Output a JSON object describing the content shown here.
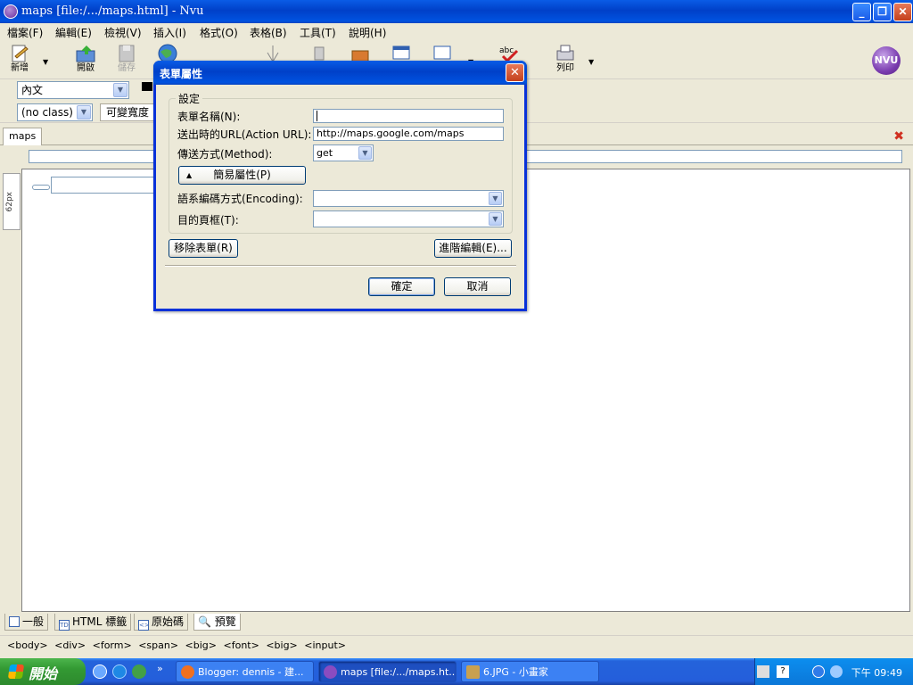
{
  "window": {
    "title": "maps [file:/.../maps.html] - Nvu"
  },
  "menu": [
    "檔案(F)",
    "編輯(E)",
    "檢視(V)",
    "插入(I)",
    "格式(O)",
    "表格(B)",
    "工具(T)",
    "說明(H)"
  ],
  "toolbar": {
    "new_label": "新增",
    "open_label": "開啟",
    "save_label": "儲存",
    "print_label": "列印",
    "logo_text": "NVU"
  },
  "format": {
    "paragraph_style": "內文",
    "class_value": "(no class)",
    "width_button": "可變寬度"
  },
  "document": {
    "tab_label": "maps",
    "side_ruler": "62px"
  },
  "mode_tabs": {
    "normal": "一般",
    "html_tags": "HTML 標籤",
    "source": "原始碼",
    "preview": "預覽"
  },
  "status": {
    "tags": "<body> <div> <form> <span> <big> <font> <big> <input>"
  },
  "dialog": {
    "title": "表單屬性",
    "group_label": "設定",
    "form_name_label": "表單名稱(N):",
    "form_name_value": "",
    "action_url_label": "送出時的URL(Action URL):",
    "action_url_value": "http://maps.google.com/maps",
    "method_label": "傳送方式(Method):",
    "method_value": "get",
    "simple_props_button": "簡易屬性(P)",
    "encoding_label": "語系編碼方式(Encoding):",
    "encoding_value": "",
    "target_label": "目的頁框(T):",
    "target_value": "",
    "remove_form_button": "移除表單(R)",
    "advanced_edit_button": "進階編輯(E)...",
    "ok_button": "確定",
    "cancel_button": "取消"
  },
  "taskbar": {
    "start_label": "開始",
    "tasks": [
      "Blogger: dennis - 建...",
      "maps [file:/.../maps.ht...",
      "6.JPG - 小畫家"
    ],
    "clock": "下午 09:49"
  }
}
